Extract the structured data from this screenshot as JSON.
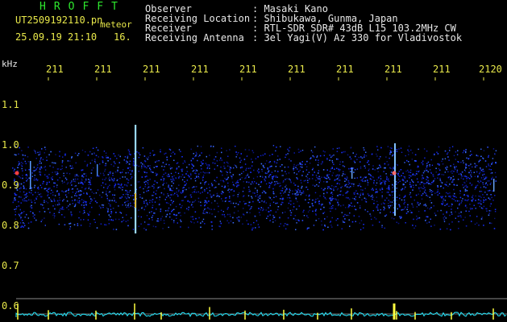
{
  "header": {
    "hrofft": "HROFFT",
    "filename": "UT2509192110.pn",
    "meteor_label": "meteor",
    "datetime": "25.09.19 21:10",
    "count": "16."
  },
  "info": {
    "observer_label": "Observer",
    "observer_value": ": Masaki Kano",
    "location_label": "Receiving Location",
    "location_value": ": Shibukawa, Gunma, Japan",
    "receiver_label": "Receiver",
    "receiver_value": ": RTL-SDR SDR# 43dB L15 103.2MHz CW",
    "antenna_label": "Receiving Antenna",
    "antenna_value": ": 3el Yagi(V) Az 330 for Vladivostok"
  },
  "axes": {
    "y_unit": "kHz",
    "y_ticks": [
      "1.1",
      "1.0",
      "0.9",
      "0.8",
      "0.7",
      "0.6"
    ],
    "x_ticks": [
      "211",
      "211",
      "211",
      "211",
      "211",
      "211",
      "211",
      "211",
      "211",
      "2120"
    ]
  },
  "colors": {
    "text_green": "#2ee82e",
    "text_yellow": "#e8e84a",
    "text_white": "#e8e8e8",
    "signal_band": "#1c2cff",
    "spectrum_trace": "#22e8ff",
    "spectrum_peak": "#ffff40"
  }
}
